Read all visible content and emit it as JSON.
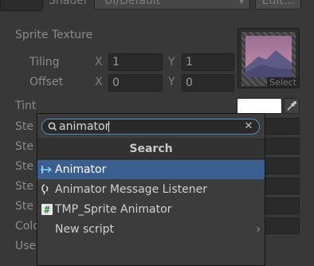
{
  "shader": {
    "label": "Shader",
    "value": "UI/Default",
    "edit_label": "Edit..."
  },
  "sprite_texture": {
    "label": "Sprite Texture",
    "select_label": "Select"
  },
  "tiling": {
    "label": "Tiling",
    "x_axis": "X",
    "x_value": "1",
    "y_axis": "Y",
    "y_value": "1"
  },
  "offset": {
    "label": "Offset",
    "x_axis": "X",
    "x_value": "0",
    "y_axis": "Y",
    "y_value": "0"
  },
  "tint": {
    "label": "Tint",
    "color": "#ffffff"
  },
  "background_labels": [
    "Ste",
    "Ste",
    "Ste",
    "Ste",
    "Ste",
    "Colo",
    "Use"
  ],
  "popup": {
    "search_value": "animator",
    "header": "Search",
    "results": [
      {
        "label": "Animator",
        "icon": "animator-icon",
        "selected": true
      },
      {
        "label": "Animator Message Listener",
        "icon": "script-icon",
        "selected": false
      },
      {
        "label": "TMP_Sprite Animator",
        "icon": "hash-script-icon",
        "selected": false
      },
      {
        "label": "New script",
        "icon": "",
        "selected": false,
        "submenu": true
      }
    ]
  },
  "colors": {
    "accent": "#3b5e90",
    "search_border": "#5b86c3",
    "background": "#383838"
  }
}
